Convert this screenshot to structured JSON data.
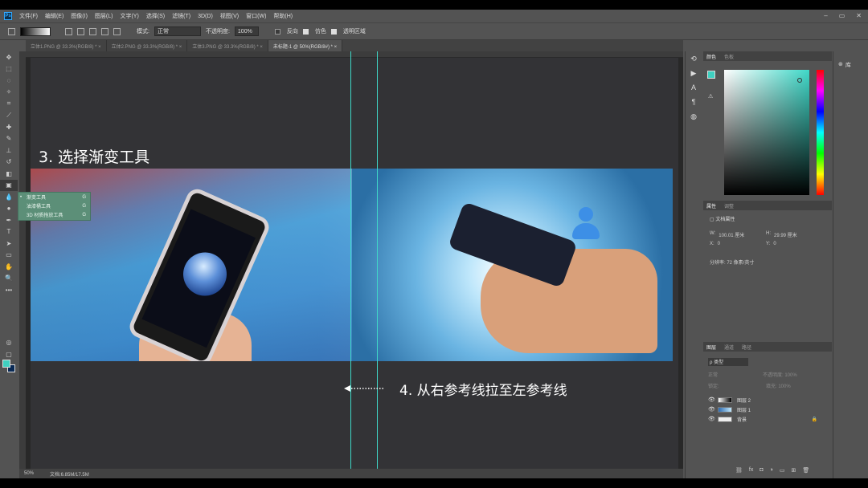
{
  "menubar": {
    "logo": "Ps",
    "items": [
      "文件(F)",
      "编辑(E)",
      "图像(I)",
      "图层(L)",
      "文字(Y)",
      "选择(S)",
      "滤镜(T)",
      "3D(D)",
      "视图(V)",
      "窗口(W)",
      "帮助(H)"
    ],
    "window_controls": [
      "–",
      "▭",
      "✕"
    ]
  },
  "options": {
    "mode_label": "模式:",
    "mode_value": "正常",
    "opacity_label": "不透明度:",
    "opacity_value": "100%",
    "reverse": "反向",
    "dither": "仿色",
    "transparency": "透明区域"
  },
  "tabs": [
    {
      "label": "立体1.PNG @ 33.3%(RGB/8) * ×",
      "active": false
    },
    {
      "label": "立体2.PNG @ 33.3%(RGB/8) * ×",
      "active": false
    },
    {
      "label": "立体3.PNG @ 33.3%(RGB/8) * ×",
      "active": false
    },
    {
      "label": "未标题-1 @ 50%(RGB/8#) * ×",
      "active": true
    }
  ],
  "flyout": {
    "items": [
      {
        "label": "渐变工具",
        "key": "G"
      },
      {
        "label": "油漆桶工具",
        "key": "G"
      },
      {
        "label": "3D 材质拖放工具",
        "key": "G"
      }
    ]
  },
  "annotations": {
    "step3": "3. 选择渐变工具",
    "step4": "4. 从右参考线拉至左参考线"
  },
  "status": {
    "zoom": "50%",
    "doc": "文档:6.85M/17.5M"
  },
  "color_panel": {
    "tabs": [
      "颜色",
      "色板"
    ],
    "foreground": "#3fd0c0",
    "background": "#0a2a55"
  },
  "properties_panel": {
    "tabs": [
      "属性",
      "调整"
    ],
    "section": "文档属性",
    "w_label": "W:",
    "w_value": "100.01 厘米",
    "h_label": "H:",
    "h_value": "29.99 厘米",
    "x_label": "X:",
    "x_value": "0",
    "y_label": "Y:",
    "y_value": "0",
    "resolution": "分辨率: 72 像素/英寸"
  },
  "layers_panel": {
    "tabs": [
      "图层",
      "通道",
      "路径"
    ],
    "filter": "ρ 类型",
    "blend": "正常",
    "opacity": "不透明度: 100%",
    "lock": "锁定:",
    "fill": "填充: 100%",
    "layers": [
      {
        "name": "图层 2"
      },
      {
        "name": "图层 1"
      },
      {
        "name": "背景"
      }
    ]
  },
  "library": {
    "label": "库"
  }
}
